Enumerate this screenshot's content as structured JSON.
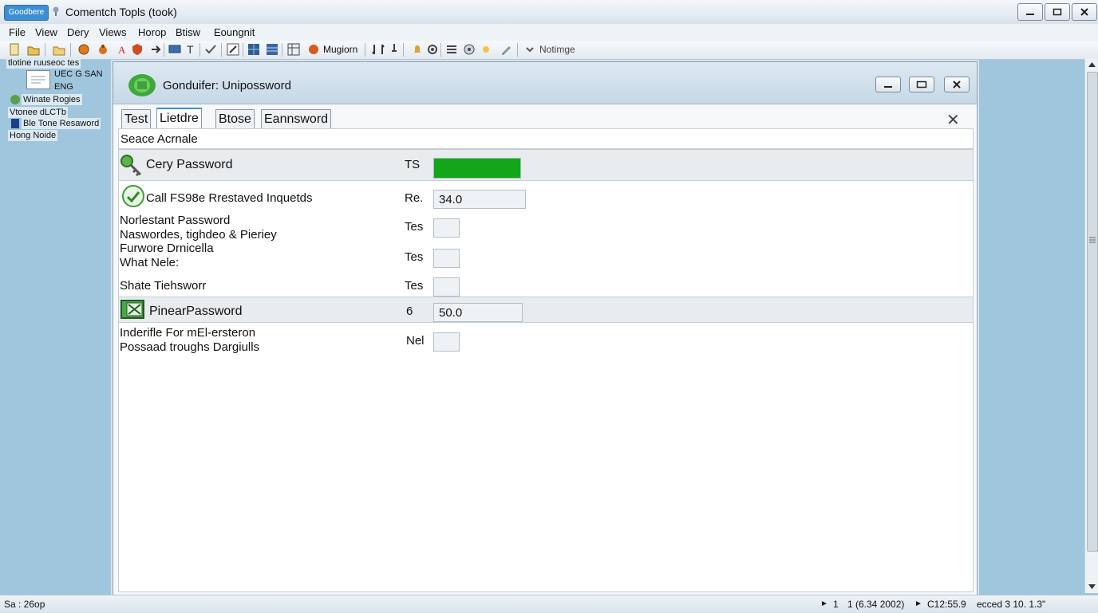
{
  "app": {
    "badge": "Goodbere",
    "title": "Comentch Topls (took)"
  },
  "menu": [
    "File",
    "View",
    "Dery",
    "Views",
    "Horop",
    "Btisw",
    "Eoungnit"
  ],
  "toolbar": {
    "label1": "Mugiorn",
    "label2": "Notimge"
  },
  "tree": {
    "items": [
      "tlotine ruuseoc tes",
      "UEC G SAN",
      "ENG",
      "Winate Rogies",
      "Vtonee dLCTb",
      "Ble Tone Resaword",
      "Hong Noide"
    ]
  },
  "dialog": {
    "title": "Gonduifer: Unipossword",
    "tabs": [
      "Test",
      "Lietdre",
      "Btose",
      "Eannsword"
    ],
    "active_tab": "Lietdre",
    "section": "Seace Acrnale",
    "rows": {
      "r1": {
        "label": "Cery Password",
        "code": "TS",
        "progress": 1.0
      },
      "r2": {
        "label": "Call FS98e Rrestaved Inquetds",
        "code": "Re.",
        "value": "34.0"
      },
      "r3": {
        "line1": "Norlestant Password",
        "line2": "Naswordes, tighdeo & Pieriey",
        "code": "Tes"
      },
      "r4": {
        "line1": "Furwore Drnicella",
        "line2": "What Nele:",
        "code": "Tes"
      },
      "r5": {
        "label": "Shate Tiehsworr",
        "code": "Tes"
      },
      "r6": {
        "label": "PinearPassword",
        "code": "6",
        "value": "50.0"
      },
      "r7": {
        "line1": "Inderifle For mEl-ersteron",
        "line2": "Possaad troughs Dargiulls",
        "code": "Nel"
      }
    }
  },
  "status": {
    "left": "Sa : 26op",
    "arrow": "►",
    "page": "1",
    "coords": "1 (6.34 2002)",
    "rate": "C12:55.9",
    "right": "ecced 3 10. 1.3\""
  },
  "colors": {
    "accent": "#3d8fd1",
    "progress_fill": "#13a61a"
  }
}
